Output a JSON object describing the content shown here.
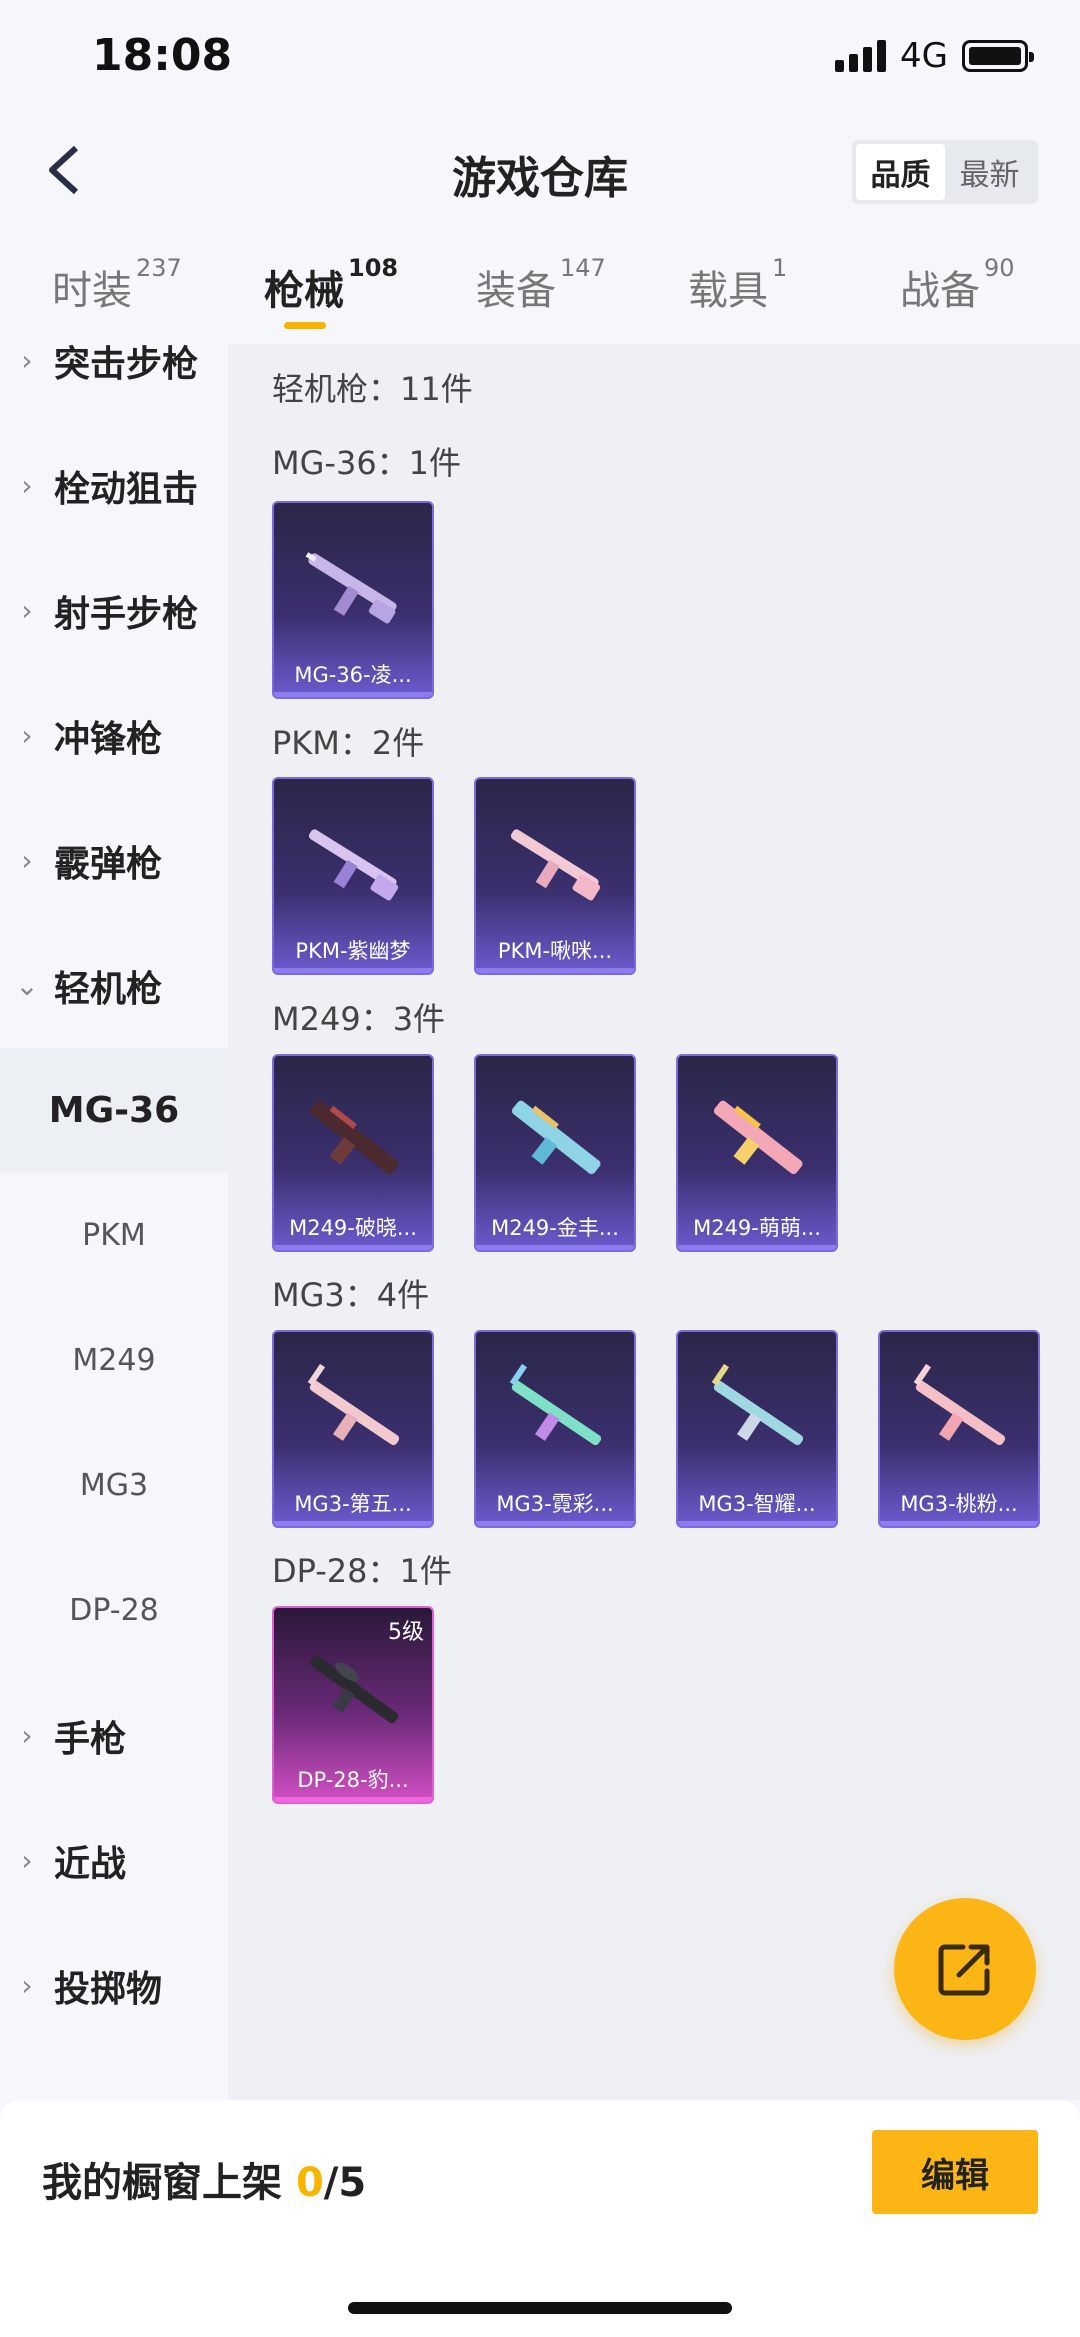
{
  "status": {
    "time": "18:08",
    "network": "4G"
  },
  "header": {
    "title": "游戏仓库",
    "sort_options": [
      "品质",
      "最新"
    ]
  },
  "tabs": [
    {
      "label": "时装",
      "count": "237"
    },
    {
      "label": "枪械",
      "count": "108"
    },
    {
      "label": "装备",
      "count": "147"
    },
    {
      "label": "载具",
      "count": "1"
    },
    {
      "label": "战备",
      "count": "90"
    }
  ],
  "sidebar": {
    "categories": [
      "突击步枪",
      "栓动狙击",
      "射手步枪",
      "冲锋枪",
      "霰弹枪",
      "轻机枪",
      "手枪",
      "近战",
      "投掷物"
    ],
    "subcategories": [
      "MG-36",
      "PKM",
      "M249",
      "MG3",
      "DP-28"
    ],
    "selected": "MG-36"
  },
  "content": {
    "section_label": "轻机枪：11件",
    "groups": [
      {
        "label": "MG-36：1件",
        "items": [
          {
            "name": "MG-36-凌..."
          }
        ]
      },
      {
        "label": "PKM：2件",
        "items": [
          {
            "name": "PKM-紫幽梦"
          },
          {
            "name": "PKM-啾咪..."
          }
        ]
      },
      {
        "label": "M249：3件",
        "items": [
          {
            "name": "M249-破晓..."
          },
          {
            "name": "M249-金丰..."
          },
          {
            "name": "M249-萌萌..."
          }
        ]
      },
      {
        "label": "MG3：4件",
        "items": [
          {
            "name": "MG3-第五..."
          },
          {
            "name": "MG3-霓彩..."
          },
          {
            "name": "MG3-智耀..."
          },
          {
            "name": "MG3-桃粉..."
          }
        ]
      },
      {
        "label": "DP-28：1件",
        "items": [
          {
            "name": "DP-28-豹...",
            "level": "5级"
          }
        ]
      }
    ]
  },
  "footer": {
    "label": "我的橱窗上架",
    "count": "0",
    "total": "/5",
    "edit_label": "编辑"
  },
  "colors": {
    "accent": "#fbb514",
    "card_purple": "#6b5bcf",
    "card_pink": "#d24fc4"
  }
}
